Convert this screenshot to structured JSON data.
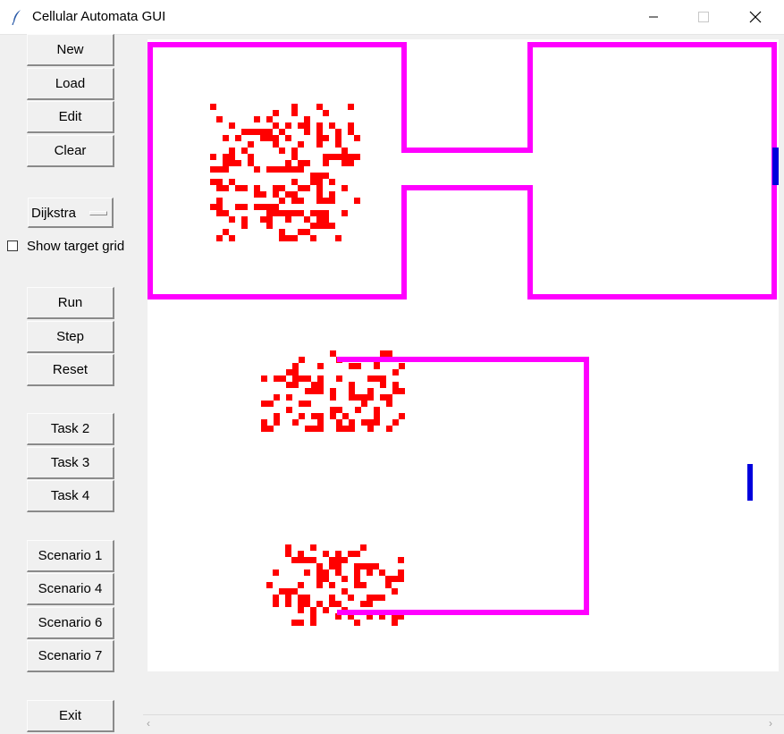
{
  "window": {
    "title": "Cellular Automata GUI"
  },
  "toolbar": {
    "new": "New",
    "load": "Load",
    "edit": "Edit",
    "clear": "Clear",
    "algorithm": "Dijkstra",
    "show_target_grid": "Show target grid",
    "run": "Run",
    "step": "Step",
    "reset": "Reset",
    "task2": "Task 2",
    "task3": "Task 3",
    "task4": "Task 4",
    "scenario1": "Scenario 1",
    "scenario4": "Scenario 4",
    "scenario6": "Scenario 6",
    "scenario7": "Scenario 7",
    "exit": "Exit"
  },
  "colors": {
    "wall": "#ff00ff",
    "pedestrian": "#ff0000",
    "target": "#0000dd",
    "canvas": "#ffffff"
  }
}
